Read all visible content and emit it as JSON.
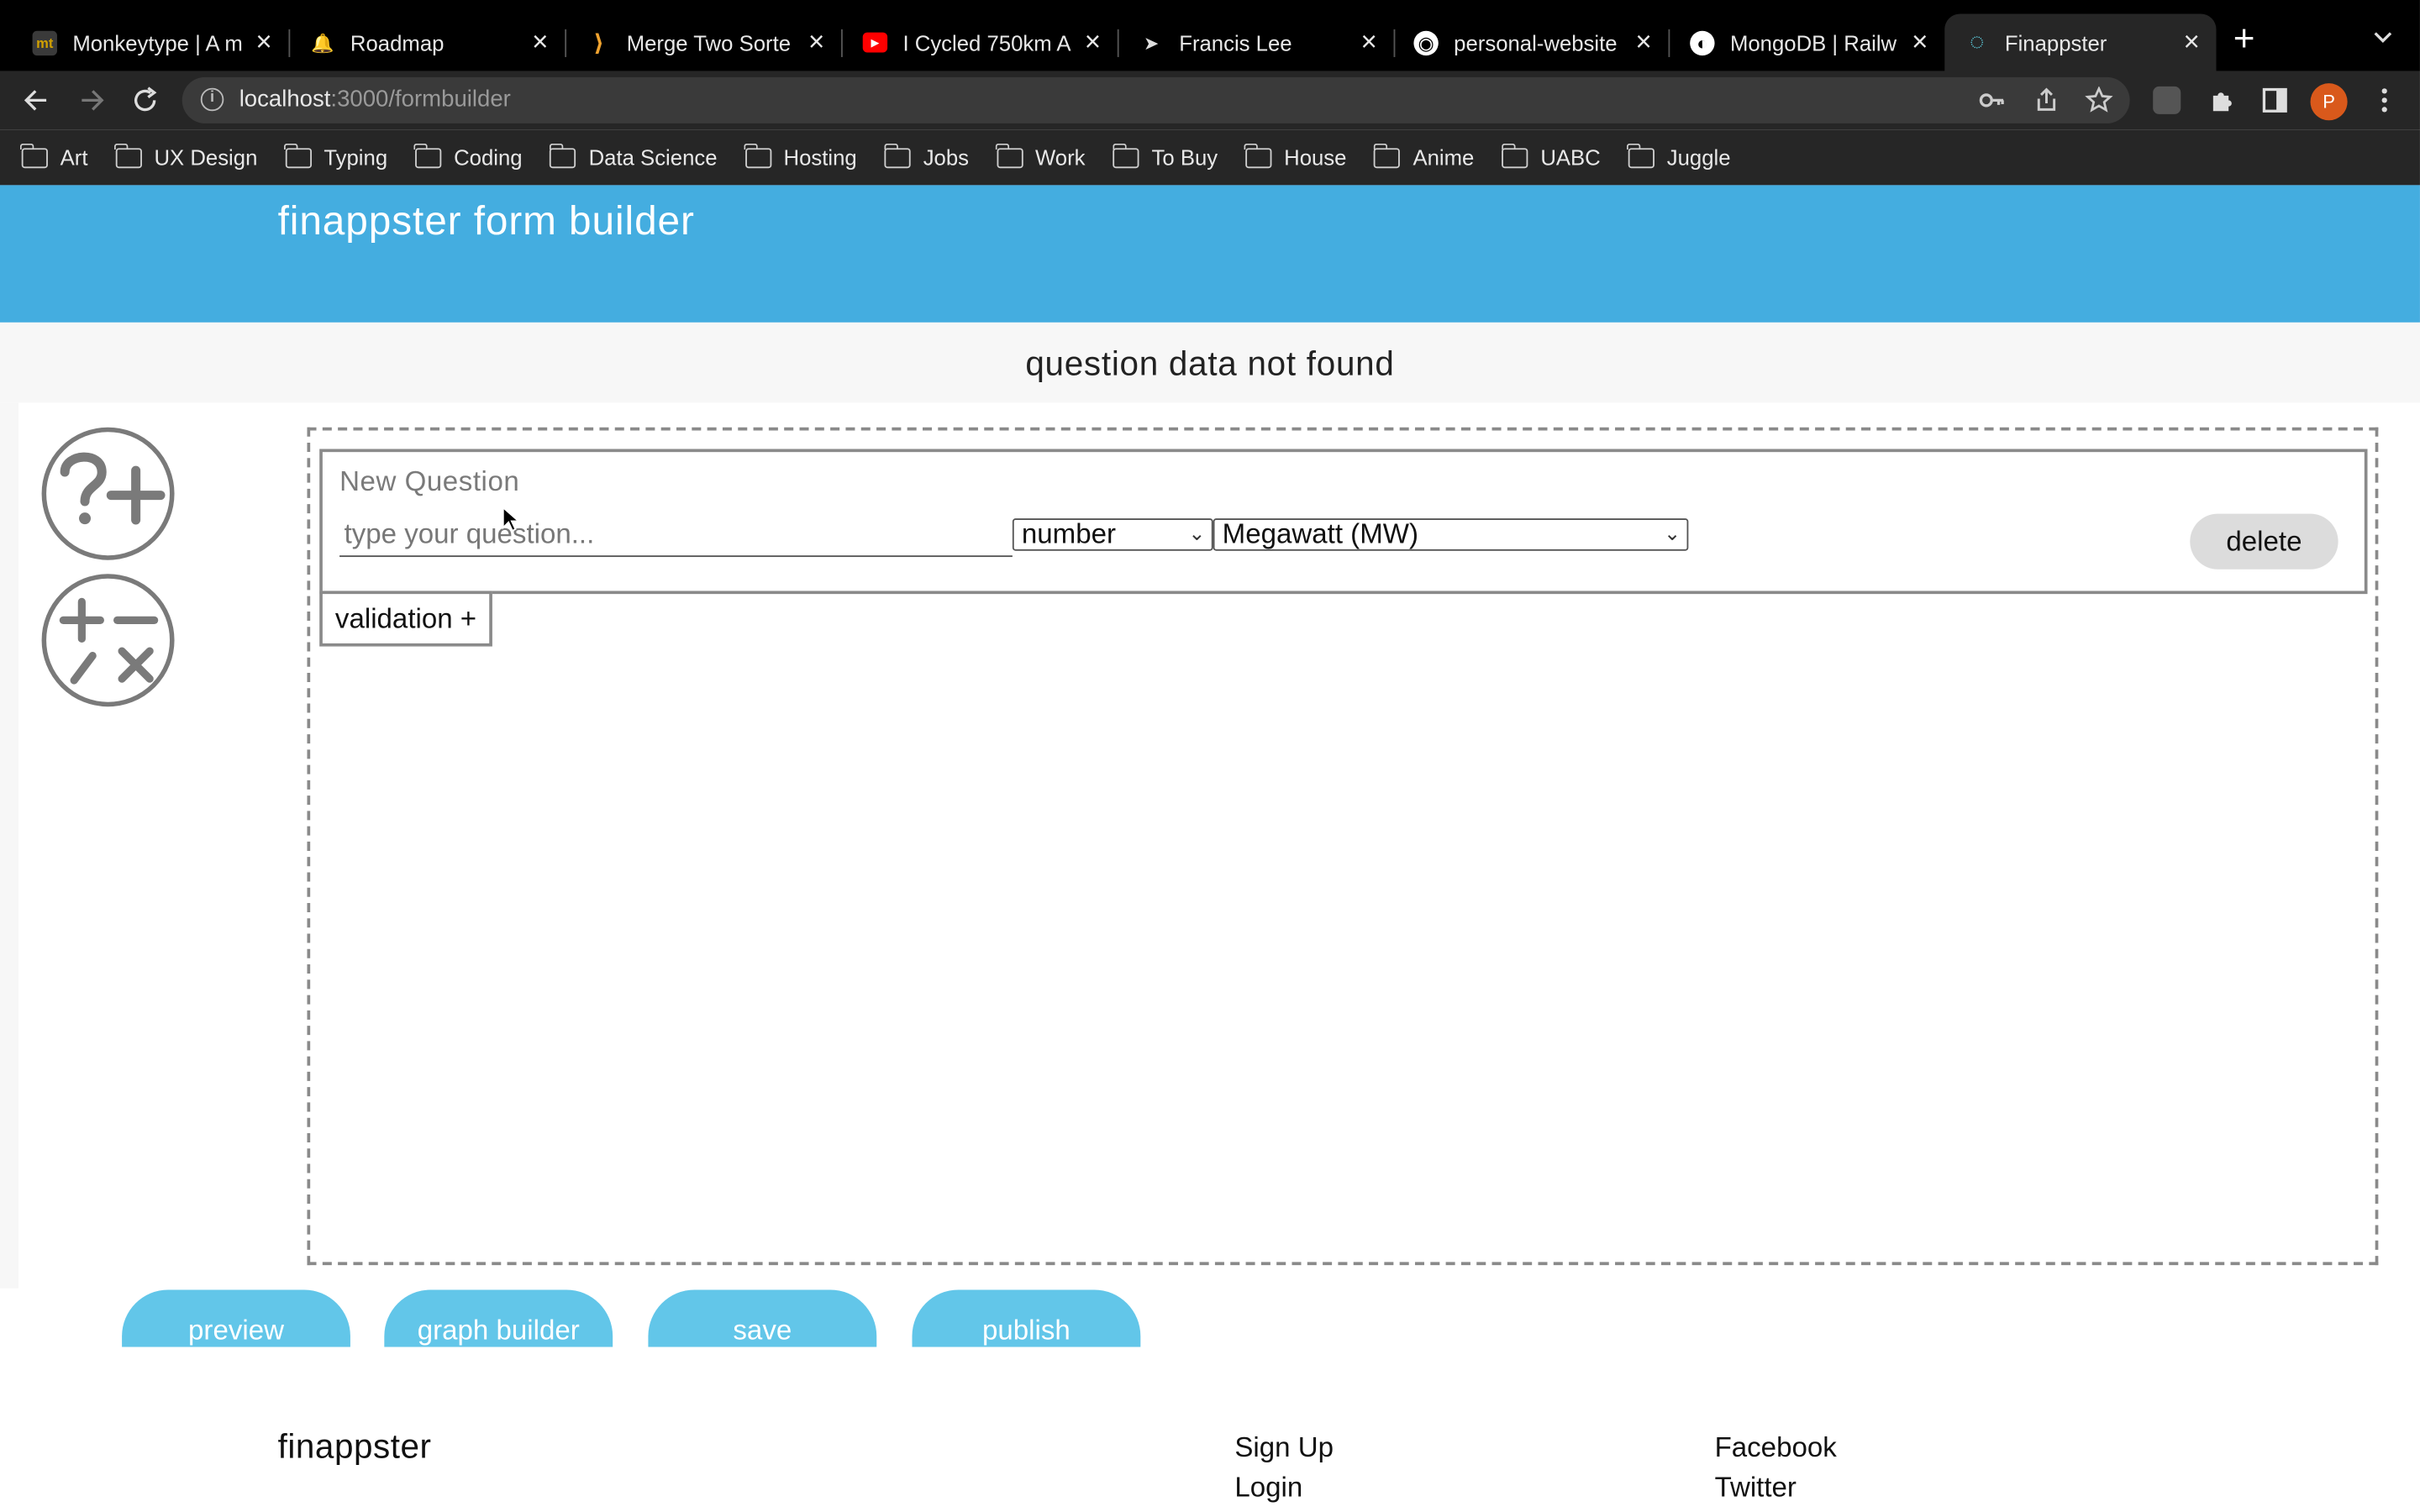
{
  "browser": {
    "tabs": [
      {
        "title": "Monkeytype | A m",
        "favicon": "monkeytype-icon",
        "fav_text": "mt",
        "fav_color": "#d1a000",
        "active": false
      },
      {
        "title": "Roadmap",
        "favicon": "roadmap-icon",
        "fav_text": "🔔",
        "fav_color": "#000000",
        "active": false
      },
      {
        "title": "Merge Two Sorte",
        "favicon": "leetcode-icon",
        "fav_text": "⟩",
        "fav_color": "#000000",
        "active": false
      },
      {
        "title": "I Cycled 750km A",
        "favicon": "youtube-icon",
        "fav_text": "▶",
        "fav_color": "#ff0000",
        "active": false
      },
      {
        "title": "Francis Lee",
        "favicon": "paper-plane-icon",
        "fav_text": "➤",
        "fav_color": "#000000",
        "active": false
      },
      {
        "title": "personal-website",
        "favicon": "github-icon",
        "fav_text": "◉",
        "fav_color": "#000000",
        "active": false
      },
      {
        "title": "MongoDB | Railw",
        "favicon": "railway-icon",
        "fav_text": "◐",
        "fav_color": "#000000",
        "active": false
      },
      {
        "title": "Finappster",
        "favicon": "loading-icon",
        "fav_text": "◌",
        "fav_color": "#262626",
        "active": true
      }
    ],
    "new_tab_label": "+",
    "address": {
      "host": "localhost",
      "path": ":3000/formbuilder"
    },
    "profile_initial": "P",
    "profile_color": "#d9591b",
    "bookmarks": [
      "Art",
      "UX Design",
      "Typing",
      "Coding",
      "Data Science",
      "Hosting",
      "Jobs",
      "Work",
      "To Buy",
      "House",
      "Anime",
      "UABC",
      "Juggle"
    ]
  },
  "app": {
    "title": "finappster form builder",
    "header_color": "#44ade0",
    "notice": "question data not found",
    "tools": [
      {
        "name": "add-question-tool",
        "icon": "question-plus-icon"
      },
      {
        "name": "add-calculation-tool",
        "icon": "math-operators-icon"
      }
    ],
    "question": {
      "label": "New Question",
      "input_value": "",
      "input_placeholder": "type your question...",
      "type_select": "number",
      "unit_select": "Megawatt (MW)",
      "delete_label": "delete"
    },
    "validation_label": "validation +",
    "actions": [
      "preview",
      "graph builder",
      "save",
      "publish"
    ],
    "action_color": "#62c6e9"
  },
  "footer": {
    "brand": "finappster",
    "links_col1": [
      "Sign Up",
      "Login"
    ],
    "links_col2": [
      "Facebook",
      "Twitter"
    ]
  }
}
